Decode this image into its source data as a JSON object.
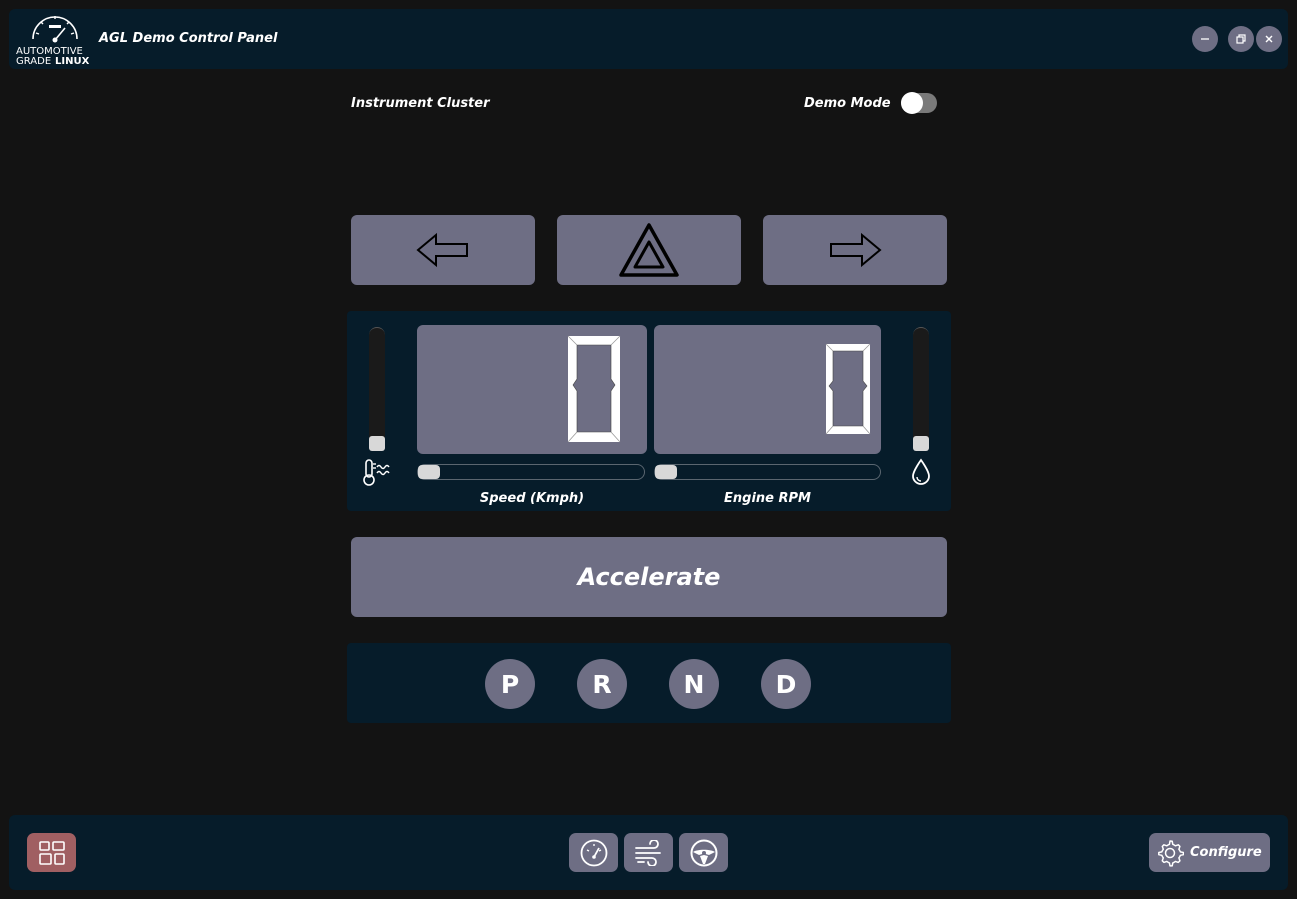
{
  "titlebar": {
    "logo_text_top": "AUTOMOTIVE",
    "logo_text_grade": "GRADE",
    "logo_text_linux": "LINUX",
    "title": "AGL Demo Control Panel"
  },
  "header": {
    "section_label": "Instrument Cluster",
    "demo_mode_label": "Demo Mode",
    "demo_mode_on": false
  },
  "cluster": {
    "speed_value": "0",
    "rpm_value": "0",
    "speed_label": "Speed (Kmph)",
    "rpm_label": "Engine RPM",
    "coolant_level": 0,
    "fuel_level": 0,
    "speed_slider": 0,
    "rpm_slider": 0
  },
  "controls": {
    "accelerate_label": "Accelerate",
    "gears": [
      "P",
      "R",
      "N",
      "D"
    ]
  },
  "bottom": {
    "configure_label": "Configure"
  },
  "colors": {
    "background": "#131313",
    "panel": "#061c2a",
    "button": "#6e6e84",
    "home_button": "#a05f62"
  }
}
